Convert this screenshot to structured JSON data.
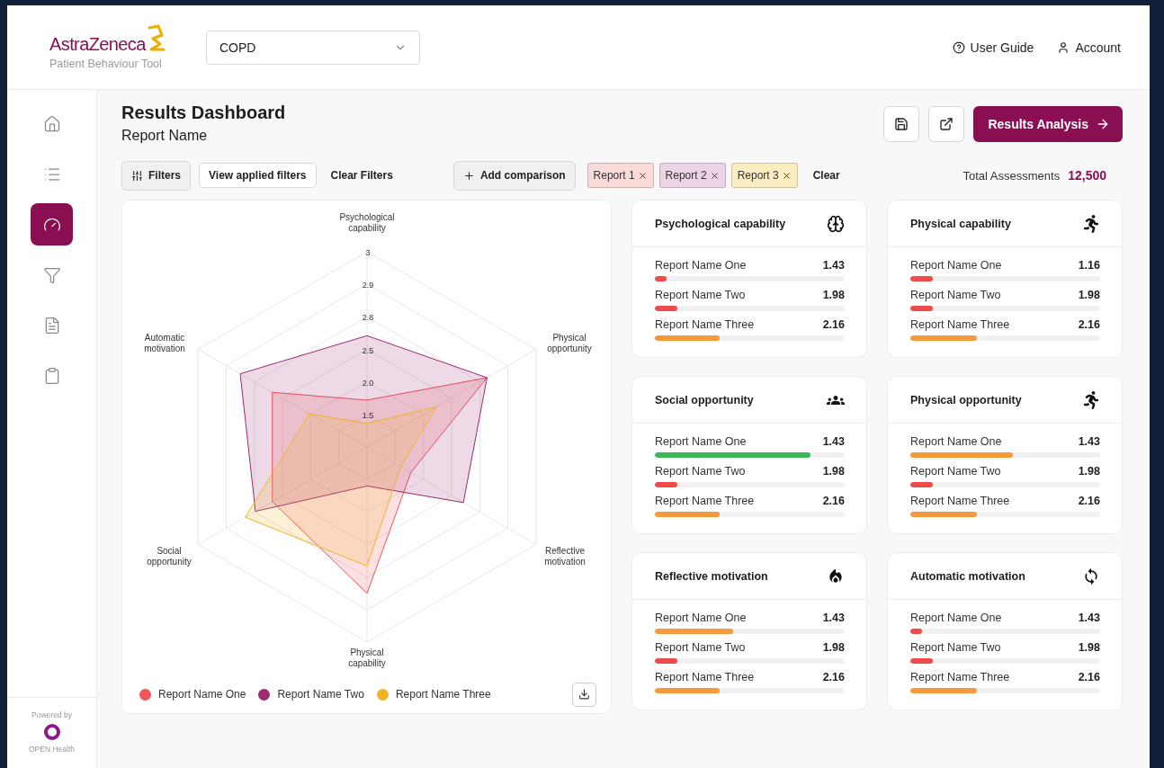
{
  "header": {
    "logo": {
      "name": "AstraZeneca",
      "subtitle": "Patient Behaviour Tool"
    },
    "condition_select": {
      "value": "COPD"
    },
    "links": [
      "User Guide",
      "Account"
    ]
  },
  "sidebar": {
    "items": [
      {
        "selected": false
      },
      {
        "selected": false
      },
      {
        "selected": true
      },
      {
        "selected": false
      },
      {
        "selected": false
      },
      {
        "selected": false
      }
    ],
    "footer": {
      "caption": "Powered by",
      "brand": "OPEN Health"
    }
  },
  "page": {
    "title": "Results Dashboard",
    "subtitle": "Report Name",
    "primary_action": "Results Analysis"
  },
  "toolbar": {
    "filters": "Filters",
    "view_filters": "View applied filters",
    "clear_filters": "Clear Filters",
    "add_comparison": "Add comparison",
    "comparisons": [
      {
        "label": "Report 1",
        "color": "#fbdada"
      },
      {
        "label": "Report 2",
        "color": "#ecd3e6"
      },
      {
        "label": "Report 3",
        "color": "#fdeec2"
      }
    ],
    "clear": "Clear",
    "total_label": "Total Assessments",
    "total_value": "12,500"
  },
  "radar": {
    "axes": [
      "Psychological capability",
      "Automatic motivation",
      "Physical opportunity",
      "Social opportunity",
      "Reflective motivation",
      "Physical capability"
    ],
    "ticks": [
      "3",
      "2.9",
      "2.8",
      "2.5",
      "2.0",
      "1.5"
    ],
    "legend": [
      {
        "name": "Report Name One",
        "color": "#f2555a"
      },
      {
        "name": "Report Name Two",
        "color": "#9e2a72"
      },
      {
        "name": "Report Name Three",
        "color": "#f0b323"
      }
    ]
  },
  "cards": [
    {
      "title": "Psychological capability",
      "rows": [
        {
          "name": "Report Name One",
          "value": "1.43",
          "level": 0.06,
          "color": "#ef4b4b"
        },
        {
          "name": "Report Name Two",
          "value": "1.98",
          "level": 0.12,
          "color": "#ef4b4b"
        },
        {
          "name": "Report Name Three",
          "value": "2.16",
          "level": 0.34,
          "color": "#f5993a"
        }
      ]
    },
    {
      "title": "Physical capability",
      "rows": [
        {
          "name": "Report Name One",
          "value": "1.16",
          "level": 0.12,
          "color": "#ef4b4b"
        },
        {
          "name": "Report Name Two",
          "value": "1.98",
          "level": 0.12,
          "color": "#ef4b4b"
        },
        {
          "name": "Report Name Three",
          "value": "2.16",
          "level": 0.35,
          "color": "#f5993a"
        }
      ]
    },
    {
      "title": "Social opportunity",
      "rows": [
        {
          "name": "Report Name One",
          "value": "1.43",
          "level": 0.82,
          "color": "#3cb85a"
        },
        {
          "name": "Report Name Two",
          "value": "1.98",
          "level": 0.12,
          "color": "#ef4b4b"
        },
        {
          "name": "Report Name Three",
          "value": "2.16",
          "level": 0.34,
          "color": "#f5993a"
        }
      ]
    },
    {
      "title": "Physical opportunity",
      "rows": [
        {
          "name": "Report Name One",
          "value": "1.43",
          "level": 0.54,
          "color": "#f5993a"
        },
        {
          "name": "Report Name Two",
          "value": "1.98",
          "level": 0.12,
          "color": "#ef4b4b"
        },
        {
          "name": "Report Name Three",
          "value": "2.16",
          "level": 0.35,
          "color": "#f5993a"
        }
      ]
    },
    {
      "title": "Reflective motivation",
      "rows": [
        {
          "name": "Report Name One",
          "value": "1.43",
          "level": 0.41,
          "color": "#f5993a"
        },
        {
          "name": "Report Name Two",
          "value": "1.98",
          "level": 0.12,
          "color": "#ef4b4b"
        },
        {
          "name": "Report Name Three",
          "value": "2.16",
          "level": 0.34,
          "color": "#f5993a"
        }
      ]
    },
    {
      "title": "Automatic motivation",
      "rows": [
        {
          "name": "Report Name One",
          "value": "1.43",
          "level": 0.06,
          "color": "#ef4b4b"
        },
        {
          "name": "Report Name Two",
          "value": "1.98",
          "level": 0.12,
          "color": "#ef4b4b"
        },
        {
          "name": "Report Name Three",
          "value": "2.16",
          "level": 0.35,
          "color": "#f5993a"
        }
      ]
    }
  ]
}
